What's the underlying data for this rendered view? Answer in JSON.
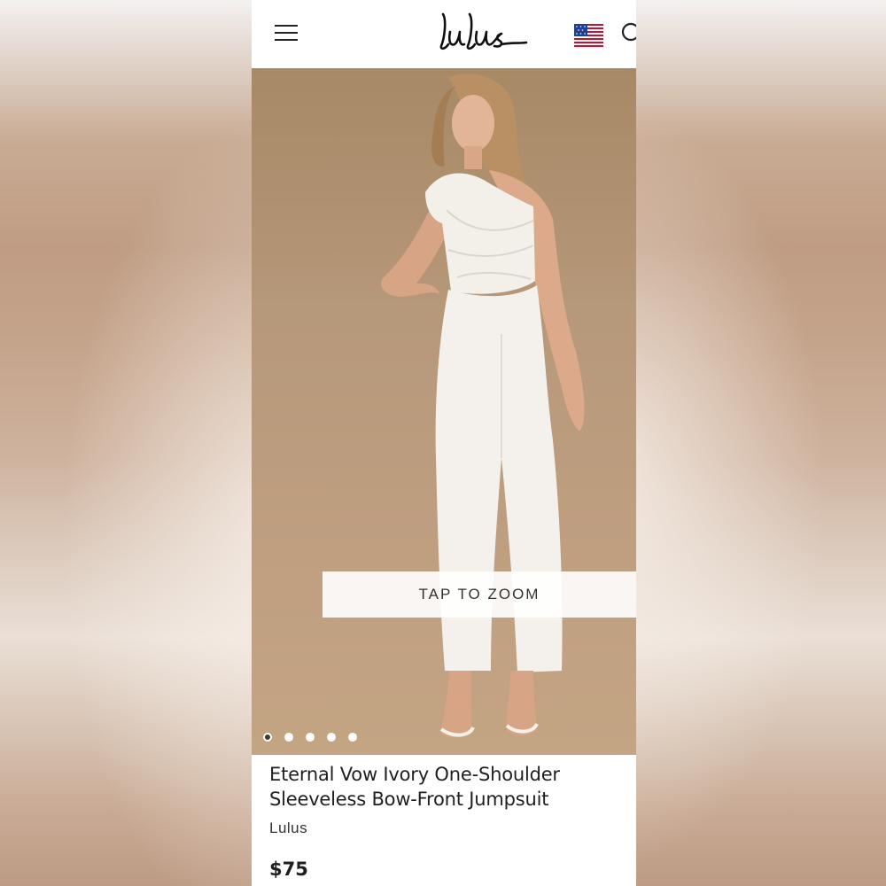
{
  "header": {
    "logo_text": "lulus",
    "menu_icon": "hamburger-menu-icon",
    "flag_icon": "us-flag-icon",
    "search_icon": "search-icon"
  },
  "gallery": {
    "zoom_label": "TAP TO ZOOM",
    "image_count": 5,
    "active_index": 0
  },
  "product": {
    "title": "Eternal Vow Ivory One-Shoulder Sleeveless Bow-Front Jumpsuit",
    "brand": "Lulus",
    "price": "$75"
  },
  "colors": {
    "hero_background": "#b6987a",
    "text": "#1f1f1f",
    "garment": "#f4f1ec"
  }
}
